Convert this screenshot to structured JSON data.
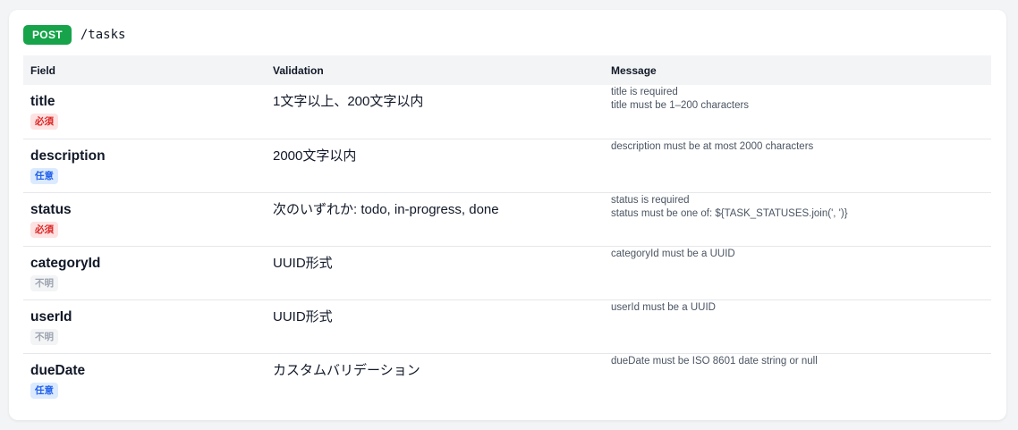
{
  "endpoint": {
    "method": "POST",
    "path": "/tasks",
    "method_color": "#16a34a"
  },
  "table": {
    "headers": {
      "field": "Field",
      "validation": "Validation",
      "message": "Message"
    },
    "rows": [
      {
        "field": "title",
        "badge": "必須",
        "badge_type": "required",
        "validation": "1文字以上、200文字以内",
        "messages": [
          "title is required",
          "title must be 1–200 characters"
        ]
      },
      {
        "field": "description",
        "badge": "任意",
        "badge_type": "optional",
        "validation": "2000文字以内",
        "messages": [
          "description must be at most 2000 characters"
        ]
      },
      {
        "field": "status",
        "badge": "必須",
        "badge_type": "required",
        "validation": "次のいずれか: todo, in-progress, done",
        "messages": [
          "status is required",
          "status must be one of: ${TASK_STATUSES.join(', ')}"
        ]
      },
      {
        "field": "categoryId",
        "badge": "不明",
        "badge_type": "unknown",
        "validation": "UUID形式",
        "messages": [
          "categoryId must be a UUID"
        ]
      },
      {
        "field": "userId",
        "badge": "不明",
        "badge_type": "unknown",
        "validation": "UUID形式",
        "messages": [
          "userId must be a UUID"
        ]
      },
      {
        "field": "dueDate",
        "badge": "任意",
        "badge_type": "optional",
        "validation": "カスタムバリデーション",
        "messages": [
          "dueDate must be ISO 8601 date string or null"
        ]
      }
    ]
  },
  "colors": {
    "required_badge_bg": "#fee2e2",
    "required_badge_text": "#dc2626",
    "optional_badge_bg": "#dbeafe",
    "optional_badge_text": "#2563eb",
    "unknown_badge_bg": "#f3f4f6",
    "unknown_badge_text": "#9ca3af"
  }
}
